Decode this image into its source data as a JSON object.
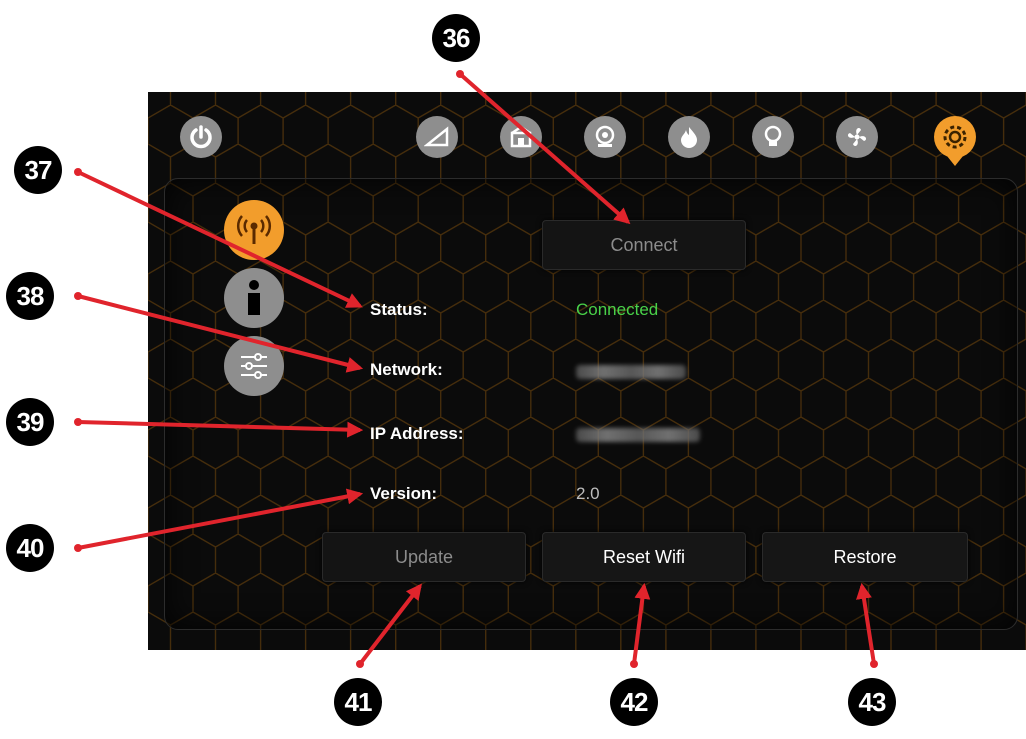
{
  "top_icons": [
    {
      "icon": "power-icon",
      "active": false
    },
    {
      "icon": "ramp-icon",
      "active": false
    },
    {
      "icon": "building-icon",
      "active": false
    },
    {
      "icon": "webcam-icon",
      "active": false
    },
    {
      "icon": "flame-icon",
      "active": false
    },
    {
      "icon": "lightbulb-icon",
      "active": false
    },
    {
      "icon": "fan-icon",
      "active": false
    },
    {
      "icon": "gear-icon",
      "active": true
    }
  ],
  "side_icons": [
    {
      "icon": "wifi-antenna-icon",
      "active": true
    },
    {
      "icon": "info-icon",
      "active": false
    },
    {
      "icon": "sliders-icon",
      "active": false
    }
  ],
  "connect_label": "Connect",
  "fields": {
    "status_label": "Status:",
    "status_value": "Connected",
    "network_label": "Network:",
    "ip_label": "IP Address:",
    "version_label": "Version:",
    "version_value": "2.0"
  },
  "buttons": {
    "update": "Update",
    "reset_wifi": "Reset Wifi",
    "restore": "Restore"
  },
  "callouts": [
    "36",
    "37",
    "38",
    "39",
    "40",
    "41",
    "42",
    "43"
  ],
  "colors": {
    "accent": "#f29d2c",
    "status_ok": "#49d149",
    "arrow": "#e0242c",
    "hex_line": "#5a3a0e"
  }
}
